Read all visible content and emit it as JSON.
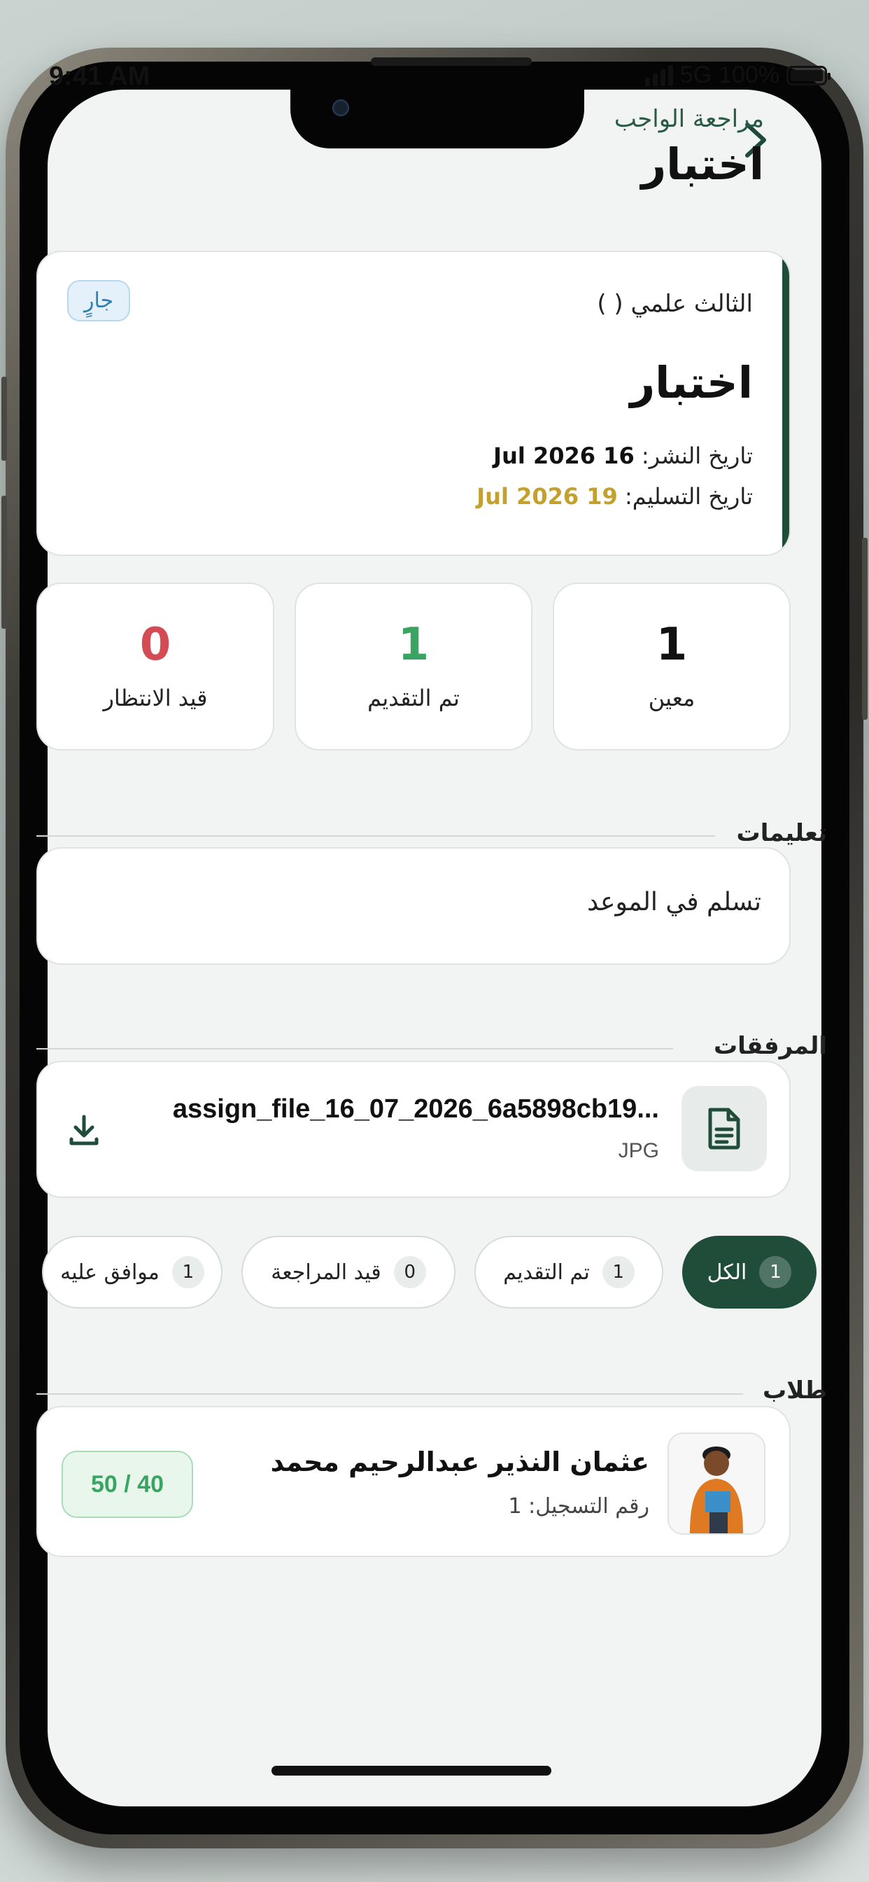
{
  "status_bar": {
    "time": "9:41 AM",
    "network": "5G",
    "battery": "100%",
    "signal_icon": "signal-bars-icon",
    "battery_icon": "battery-icon"
  },
  "header": {
    "back_icon": "chevron-right-icon",
    "subtitle": "مراجعة الواجب",
    "title": "اختبار"
  },
  "assignment": {
    "status": "جارٍ",
    "class_name": "الثالث علمي ( )",
    "title": "اختبار",
    "publish_label": "تاريخ النشر:",
    "publish_date": "16 Jul 2026",
    "due_label": "تاريخ التسليم:",
    "due_date": "19 Jul 2026",
    "accent_color": "#1f4d3a",
    "due_color": "#c4a12c"
  },
  "stats": [
    {
      "value": "1",
      "label": "معين",
      "color": "#111111"
    },
    {
      "value": "1",
      "label": "تم التقديم",
      "color": "#3aa562"
    },
    {
      "value": "0",
      "label": "قيد الانتظار",
      "color": "#d44a55"
    }
  ],
  "instructions": {
    "title": "تعليمات",
    "text": "تسلم في الموعد"
  },
  "attachments": {
    "title": "المرفقات",
    "file_name": "assign_file_16_07_2026_6a5898cb19...",
    "file_type": "JPG",
    "file_icon": "document-icon",
    "download_icon": "download-icon"
  },
  "filters": [
    {
      "label": "الكل",
      "count": "1",
      "active": true
    },
    {
      "label": "تم التقديم",
      "count": "1",
      "active": false
    },
    {
      "label": "قيد المراجعة",
      "count": "0",
      "active": false
    },
    {
      "label": "موافق عليه",
      "count": "1",
      "active": false
    }
  ],
  "students": {
    "title": "طلاب",
    "items": [
      {
        "name": "عثمان النذير عبدالرحيم محمد",
        "registration": "رقم التسجيل: 1",
        "grade": "50 / 40"
      }
    ]
  }
}
